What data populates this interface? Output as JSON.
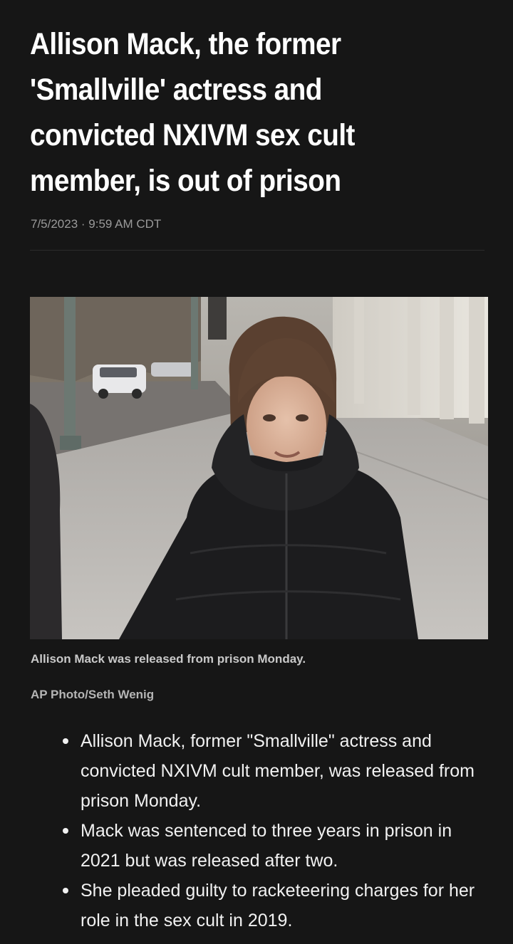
{
  "article": {
    "headline": "Allison Mack, the former 'Smallville' actress and convicted NXIVM sex cult member, is out of prison",
    "timestamp": "7/5/2023 · 9:59 AM CDT",
    "photo": {
      "subject": "woman-in-black-puffer-jacket",
      "caption": "Allison Mack was released from prison Monday.",
      "credit": "AP Photo/Seth Wenig"
    },
    "bullets": [
      "Allison Mack, former \"Smallville\" actress and convicted NXIVM cult member, was released from prison Monday.",
      "Mack was sentenced to three years in prison in 2021 but was released after two.",
      "She pleaded guilty to racketeering charges for her role in the sex cult in 2019."
    ]
  },
  "colors": {
    "background": "#161616",
    "headline": "#ffffff",
    "timestamp": "#9a9a9a",
    "caption": "#c9c9c9",
    "body_text": "#f1f1f1"
  }
}
